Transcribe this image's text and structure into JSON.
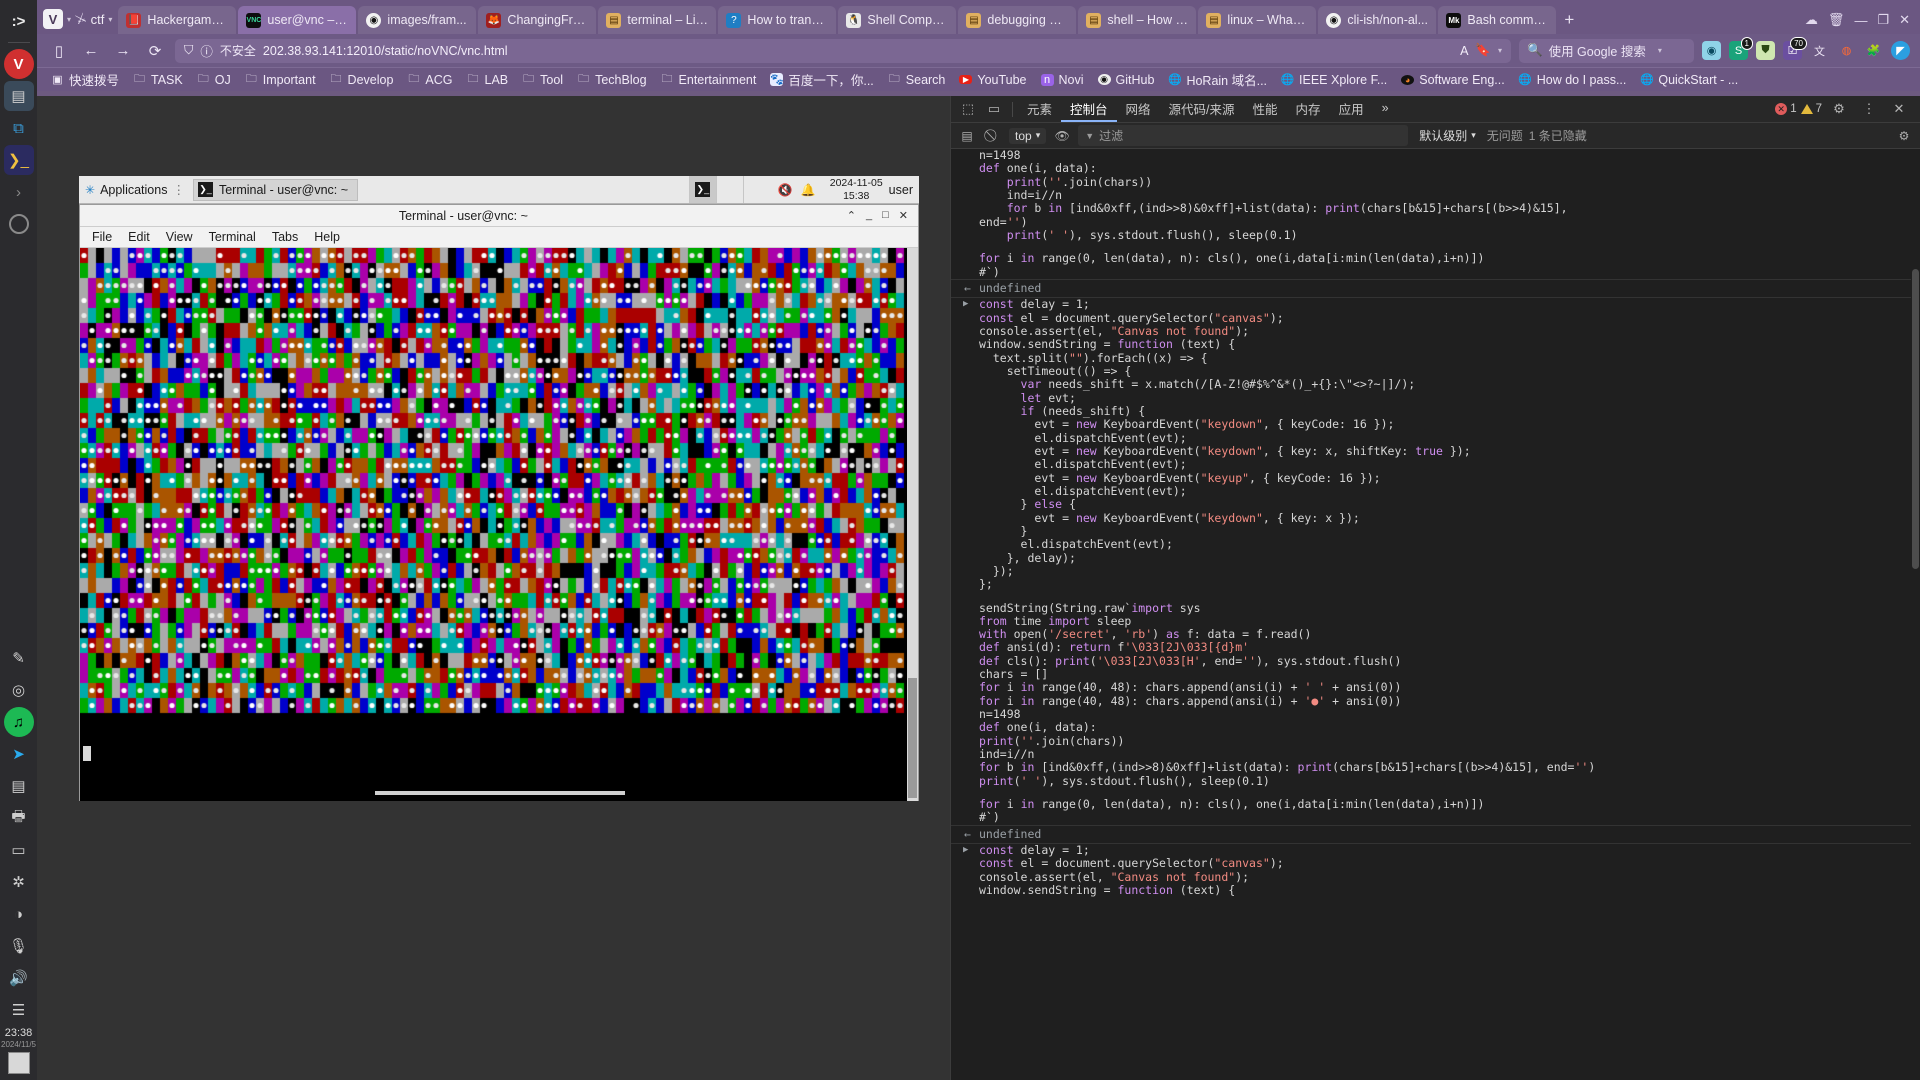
{
  "os_rail": {
    "items": [
      {
        "name": "prompt-icon",
        "glyph": ":>"
      },
      {
        "name": "files-icon",
        "glyph": "▤"
      },
      {
        "name": "vscode-icon",
        "glyph": "⧉"
      },
      {
        "name": "powershell-icon",
        "glyph": "❯_"
      },
      {
        "name": "chevron-right-icon",
        "glyph": "›"
      },
      {
        "name": "circle-app-icon",
        "glyph": ""
      },
      {
        "name": "feather-icon",
        "glyph": "✎"
      },
      {
        "name": "shield-icon",
        "glyph": "◎"
      },
      {
        "name": "spotify-icon",
        "glyph": "♫"
      },
      {
        "name": "telegram-icon",
        "glyph": "➤"
      },
      {
        "name": "notes-icon",
        "glyph": "▤"
      },
      {
        "name": "printer-icon",
        "glyph": "🖨"
      },
      {
        "name": "card-icon",
        "glyph": "▭"
      },
      {
        "name": "bluetooth-icon",
        "glyph": "✲"
      },
      {
        "name": "volume-icon",
        "glyph": "◑"
      },
      {
        "name": "mic-icon",
        "glyph": "🎤"
      },
      {
        "name": "speaker-icon",
        "glyph": "🔊"
      },
      {
        "name": "list-icon",
        "glyph": "☰"
      }
    ],
    "clock_time": "23:38",
    "clock_date": "2024/11/5"
  },
  "browser": {
    "workspace": {
      "label": "ctf",
      "logo": "V"
    },
    "tabs": [
      {
        "label": "Hackergame ...",
        "favicon": "📕",
        "fav_bg": "#c03030",
        "active": false
      },
      {
        "label": "user@vnc – noVI",
        "favicon": "VNC",
        "fav_bg": "#0f0f0f",
        "active": true
      },
      {
        "label": "images/fram...",
        "favicon": "",
        "fav_bg": "#1b1b1b",
        "active": false
      },
      {
        "label": "ChangingFra...",
        "favicon": "🦊",
        "fav_bg": "#b03030",
        "active": false
      },
      {
        "label": "terminal – Lis...",
        "favicon": "📋",
        "fav_bg": "#d6a15a",
        "active": false
      },
      {
        "label": "How to transf...",
        "favicon": "❓",
        "fav_bg": "#2277cc",
        "active": false
      },
      {
        "label": "Shell Compat...",
        "favicon": "🐧",
        "fav_bg": "#dddddd",
        "active": false
      },
      {
        "label": "debugging – I...",
        "favicon": "📋",
        "fav_bg": "#d6a15a",
        "active": false
      },
      {
        "label": "shell – How t...",
        "favicon": "📋",
        "fav_bg": "#d6a15a",
        "active": false
      },
      {
        "label": "linux – What a...",
        "favicon": "📋",
        "fav_bg": "#d6a15a",
        "active": false
      },
      {
        "label": "cli-ish/non-al...",
        "favicon": "",
        "fav_bg": "#1b1b1b",
        "active": false
      },
      {
        "label": "Bash comma...",
        "favicon": "Mk",
        "fav_bg": "#0d0d0d",
        "active": false
      }
    ],
    "new_tab_label": "+",
    "window_controls": {
      "minimize": "—",
      "maximize": "❐",
      "close": "✕"
    },
    "trash_icon": "🗑",
    "cloud_icon": "☁",
    "nav": {
      "panel_toggle": "▯",
      "back": "←",
      "forward": "→",
      "reload": "⟳"
    },
    "url": {
      "shield_icon": "shield",
      "info_icon": "ⓘ",
      "security_label": "不安全",
      "value": "202.38.93.141:12010/static/noVNC/vnc.html",
      "translate_icon": "A",
      "bookmark_icon": "🔖",
      "caret": "▾"
    },
    "search": {
      "engine_icon": "Q",
      "placeholder": "使用 Google 搜索",
      "caret": "▾"
    },
    "extensions": [
      {
        "name": "bitwarden-ext-icon",
        "glyph": "◉",
        "bg": "#8fd3e8",
        "badge": ""
      },
      {
        "name": "sider-ext-icon",
        "glyph": "S",
        "bg": "#1aa37a",
        "badge": "1"
      },
      {
        "name": "ublock-ext-icon",
        "glyph": "⛊",
        "bg": "#d4e7b5",
        "badge": ""
      },
      {
        "name": "tampermonkey-ext-icon",
        "glyph": "☑",
        "bg": "#6b4fa0",
        "badge": "70"
      },
      {
        "name": "translate-ext-icon",
        "glyph": "文",
        "bg": "transparent",
        "badge": ""
      },
      {
        "name": "reddit-ext-icon",
        "glyph": "◍",
        "bg": "#ff5722",
        "badge": ""
      },
      {
        "name": "puzzle-ext-icon",
        "glyph": "🧩",
        "bg": "transparent",
        "badge": ""
      },
      {
        "name": "profile-avatar",
        "glyph": "◤",
        "bg": "#2b9fe0",
        "badge": ""
      }
    ],
    "bookmarks": [
      {
        "label": "快速拨号",
        "icon": "speeddial"
      },
      {
        "label": "TASK",
        "icon": "folder"
      },
      {
        "label": "OJ",
        "icon": "folder"
      },
      {
        "label": "Important",
        "icon": "folder"
      },
      {
        "label": "Develop",
        "icon": "folder"
      },
      {
        "label": "ACG",
        "icon": "folder"
      },
      {
        "label": "LAB",
        "icon": "folder"
      },
      {
        "label": "Tool",
        "icon": "folder"
      },
      {
        "label": "TechBlog",
        "icon": "folder"
      },
      {
        "label": "Entertainment",
        "icon": "folder"
      },
      {
        "label": "百度一下，你...",
        "icon": "baidu"
      },
      {
        "label": "Search",
        "icon": "folder"
      },
      {
        "label": "YouTube",
        "icon": "youtube"
      },
      {
        "label": "Novi",
        "icon": "novi"
      },
      {
        "label": "GitHub",
        "icon": "github"
      },
      {
        "label": "HoRain 域名...",
        "icon": "globe"
      },
      {
        "label": "IEEE Xplore F...",
        "icon": "globe"
      },
      {
        "label": "Software Eng...",
        "icon": "stack"
      },
      {
        "label": "How do I pass...",
        "icon": "globe"
      },
      {
        "label": "QuickStart - ...",
        "icon": "globe"
      }
    ]
  },
  "vnc": {
    "xfce_panel": {
      "applications_label": "Applications",
      "applications_icon": "✳",
      "menu_glyph": "⋮",
      "task_button_label": "Terminal - user@vnc: ~",
      "task_button_icon": "❯_",
      "tray": {
        "mute_icon": "🔇",
        "bell_icon": "🔔"
      },
      "clock_time": "15:38",
      "clock_date": "2024-11-05",
      "user_label": "user"
    },
    "terminal": {
      "title": "Terminal - user@vnc: ~",
      "window_buttons": {
        "minimize": "⌃",
        "restore": "_",
        "maximize": "□",
        "close": "✕"
      },
      "menu": [
        "File",
        "Edit",
        "View",
        "Terminal",
        "Tabs",
        "Help"
      ]
    }
  },
  "devtools": {
    "tabs": [
      {
        "label": "元素",
        "active": false
      },
      {
        "label": "控制台",
        "active": true
      },
      {
        "label": "网络",
        "active": false
      },
      {
        "label": "源代码/来源",
        "active": false
      },
      {
        "label": "性能",
        "active": false
      },
      {
        "label": "内存",
        "active": false
      },
      {
        "label": "应用",
        "active": false
      }
    ],
    "more_tabs": "»",
    "inspect_icon": "⬚",
    "device_icon": "▭",
    "error_count": "1",
    "warning_count": "7",
    "settings_icon": "⚙",
    "kebab_icon": "⋮",
    "close_icon": "✕",
    "toolbar": {
      "clear_icon": "⃠",
      "sidebar_icon": "▤",
      "context": "top",
      "context_caret": "▾",
      "eye_icon": "👁",
      "filter_icon": "▼",
      "filter_placeholder": "过滤",
      "level": "默认级别",
      "level_caret": "▾",
      "issues": "无问题",
      "hidden_count": "1 条已隐藏",
      "gear_icon": "⚙"
    },
    "console_entries": [
      {
        "type": "output",
        "lines": [
          "n=1498",
          "def one(i, data):",
          "    print(''.join(chars))",
          "    ind=i//n",
          "    for b in [ind&0xff,(ind>>8)&0xff]+list(data): print(chars[b&15]+chars[(b>>4)&15],",
          "end='')",
          "    print(' '), sys.stdout.flush(), sleep(0.1)",
          "",
          "for i in range(0, len(data), n): cls(), one(i,data[i:min(len(data),i+n)])",
          "#`)"
        ]
      },
      {
        "type": "return",
        "text": "undefined"
      },
      {
        "type": "input",
        "lines": [
          "const delay = 1;",
          "const el = document.querySelector(\"canvas\");",
          "console.assert(el, \"Canvas not found\");",
          "window.sendString = function (text) {",
          "  text.split(\"\").forEach((x) => {",
          "    setTimeout(() => {",
          "      var needs_shift = x.match(/[A-Z!@#$%^&*()_+{}:\\\"<>?~|]/);",
          "      let evt;",
          "      if (needs_shift) {",
          "        evt = new KeyboardEvent(\"keydown\", { keyCode: 16 });",
          "        el.dispatchEvent(evt);",
          "        evt = new KeyboardEvent(\"keydown\", { key: x, shiftKey: true });",
          "        el.dispatchEvent(evt);",
          "        evt = new KeyboardEvent(\"keyup\", { keyCode: 16 });",
          "        el.dispatchEvent(evt);",
          "      } else {",
          "        evt = new KeyboardEvent(\"keydown\", { key: x });",
          "      }",
          "      el.dispatchEvent(evt);",
          "    }, delay);",
          "  });",
          "};",
          "",
          "sendString(String.raw`import sys",
          "from time import sleep",
          "with open('/secret', 'rb') as f: data = f.read()",
          "def ansi(d): return f'\\033[2J\\033[{d}m'",
          "def cls(): print('\\033[2J\\033[H', end=''), sys.stdout.flush()",
          "chars = []",
          "for i in range(40, 48): chars.append(ansi(i) + ' ' + ansi(0))",
          "for i in range(40, 48): chars.append(ansi(i) + '●' + ansi(0))",
          "n=1498",
          "def one(i, data):",
          "print(''.join(chars))",
          "ind=i//n",
          "for b in [ind&0xff,(ind>>8)&0xff]+list(data): print(chars[b&15]+chars[(b>>4)&15], end='')",
          "print(' '), sys.stdout.flush(), sleep(0.1)",
          "",
          "for i in range(0, len(data), n): cls(), one(i,data[i:min(len(data),i+n)])",
          "#`)"
        ]
      },
      {
        "type": "return",
        "text": "undefined"
      },
      {
        "type": "input",
        "lines": [
          "const delay = 1;",
          "const el = document.querySelector(\"canvas\");",
          "console.assert(el, \"Canvas not found\");",
          "window.sendString = function (text) {"
        ]
      }
    ]
  }
}
